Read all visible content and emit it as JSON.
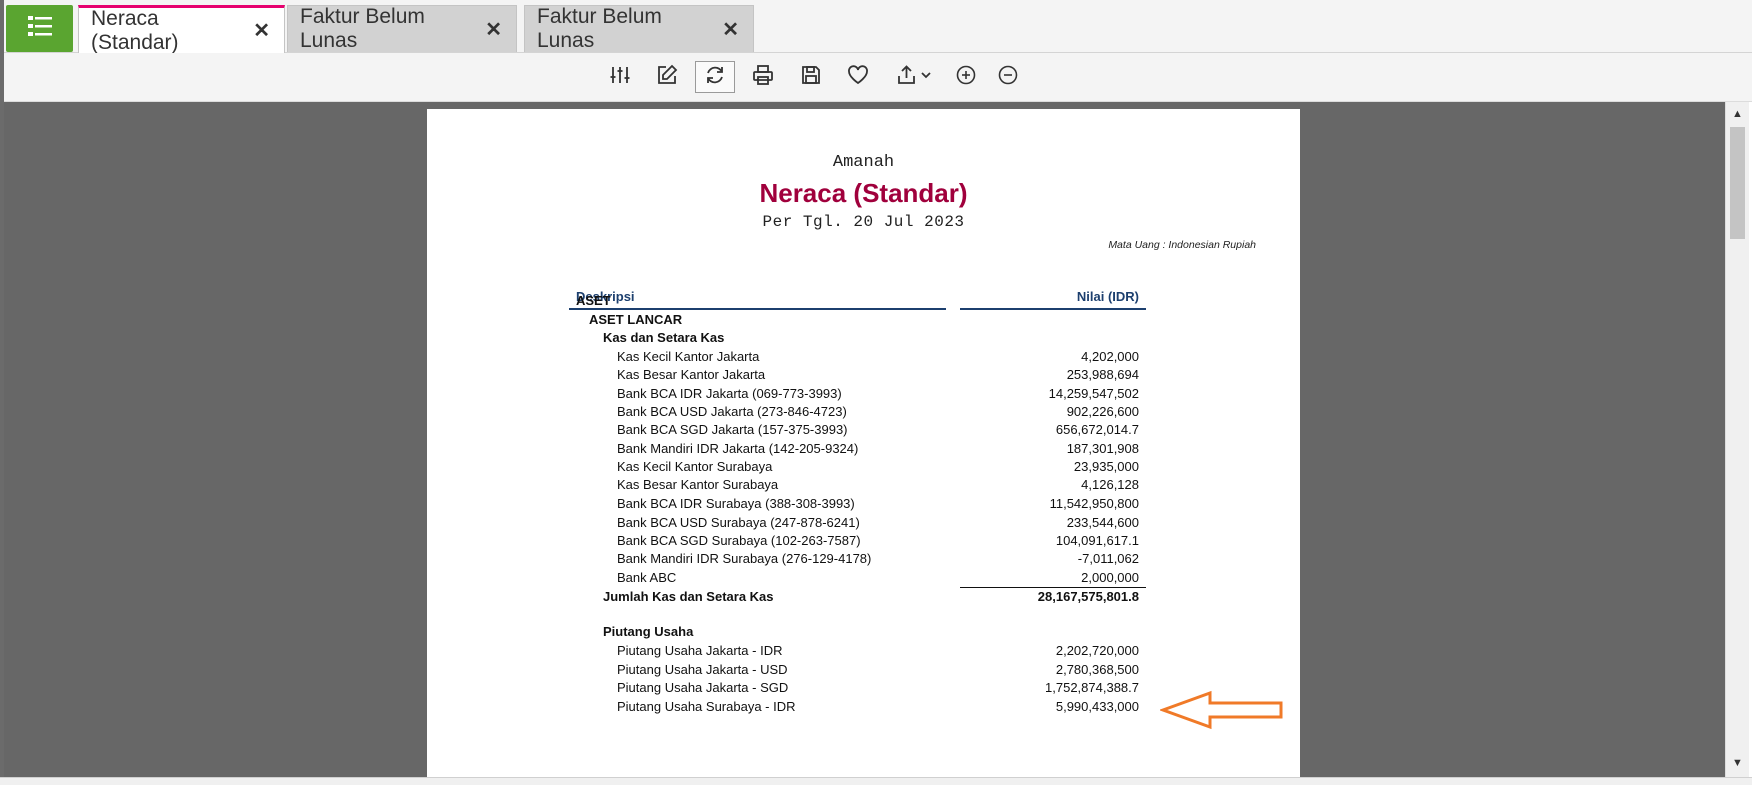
{
  "tabs": [
    {
      "label": "Neraca (Standar)",
      "active": true
    },
    {
      "label": "Faktur Belum Lunas",
      "active": false
    },
    {
      "label": "Faktur Belum Lunas",
      "active": false
    }
  ],
  "toolbar": {
    "icons": [
      "filter-sliders-icon",
      "edit-icon",
      "refresh-icon",
      "print-icon",
      "save-icon",
      "favorite-heart-icon",
      "export-icon",
      "zoom-in-icon",
      "zoom-out-icon"
    ]
  },
  "colors": {
    "accent": "#e6006e",
    "menu_green": "#5aa530",
    "report_title": "#a0003c",
    "header_blue": "#1c3f6e",
    "arrow_orange": "#f07a28"
  },
  "report": {
    "company": "Amanah",
    "title": "Neraca (Standar)",
    "date": "Per Tgl. 20 Jul 2023",
    "currency": "Mata Uang : Indonesian Rupiah",
    "col_desc": "Deskripsi",
    "col_value": "Nilai (IDR)",
    "rows": [
      {
        "label": "ASET",
        "value": "",
        "level": 0,
        "bold": true
      },
      {
        "label": "ASET LANCAR",
        "value": "",
        "level": 1,
        "bold": true
      },
      {
        "label": "Kas dan Setara Kas",
        "value": "",
        "level": 2,
        "bold": true
      },
      {
        "label": "Kas Kecil Kantor Jakarta",
        "value": "4,202,000",
        "level": 3
      },
      {
        "label": "Kas Besar Kantor Jakarta",
        "value": "253,988,694",
        "level": 3
      },
      {
        "label": "Bank BCA IDR Jakarta (069-773-3993)",
        "value": "14,259,547,502",
        "level": 3
      },
      {
        "label": "Bank BCA USD Jakarta (273-846-4723)",
        "value": "902,226,600",
        "level": 3
      },
      {
        "label": "Bank BCA SGD Jakarta (157-375-3993)",
        "value": "656,672,014.7",
        "level": 3
      },
      {
        "label": "Bank Mandiri IDR Jakarta (142-205-9324)",
        "value": "187,301,908",
        "level": 3
      },
      {
        "label": "Kas Kecil Kantor Surabaya",
        "value": "23,935,000",
        "level": 3
      },
      {
        "label": "Kas Besar Kantor Surabaya",
        "value": "4,126,128",
        "level": 3
      },
      {
        "label": "Bank BCA IDR Surabaya (388-308-3993)",
        "value": "11,542,950,800",
        "level": 3
      },
      {
        "label": "Bank BCA USD Surabaya (247-878-6241)",
        "value": "233,544,600",
        "level": 3
      },
      {
        "label": "Bank BCA SGD Surabaya (102-263-7587)",
        "value": "104,091,617.1",
        "level": 3
      },
      {
        "label": "Bank Mandiri IDR Surabaya (276-129-4178)",
        "value": "-7,011,062",
        "level": 3
      },
      {
        "label": "Bank ABC",
        "value": "2,000,000",
        "level": 3
      },
      {
        "label": "Jumlah Kas dan Setara Kas",
        "value": "28,167,575,801.8",
        "level": 2,
        "bold": true
      },
      {
        "label": "Piutang Usaha",
        "value": "",
        "level": 2,
        "bold": true
      },
      {
        "label": "Piutang Usaha Jakarta - IDR",
        "value": "2,202,720,000",
        "level": 3
      },
      {
        "label": "Piutang Usaha Jakarta - USD",
        "value": "2,780,368,500",
        "level": 3
      },
      {
        "label": "Piutang Usaha Jakarta - SGD",
        "value": "1,752,874,388.7",
        "level": 3
      },
      {
        "label": "Piutang Usaha Surabaya - IDR",
        "value": "5,990,433,000",
        "level": 3
      }
    ]
  }
}
